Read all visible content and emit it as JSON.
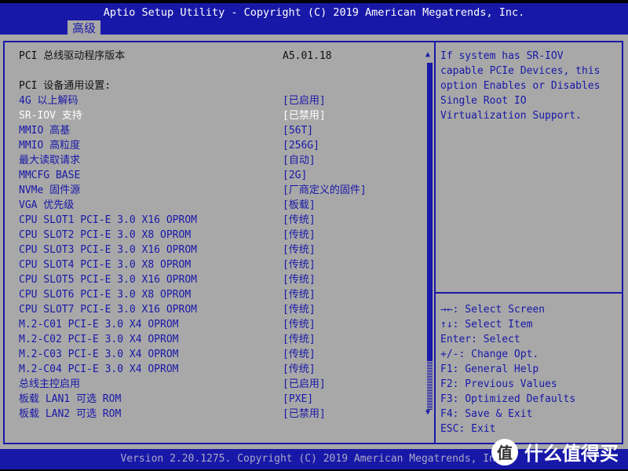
{
  "header": {
    "title": "Aptio Setup Utility - Copyright (C) 2019 American Megatrends, Inc.",
    "tab": "高级"
  },
  "items": [
    {
      "label": "PCI 总线驱动程序版本",
      "value": "A5.01.18",
      "style": "static"
    },
    {
      "label": "",
      "value": "",
      "style": "static"
    },
    {
      "label": "PCI 设备通用设置:",
      "value": "",
      "style": "static"
    },
    {
      "label": "4G 以上解码",
      "value": "[已启用]",
      "style": "link"
    },
    {
      "label": "SR-IOV 支持",
      "value": "[已禁用]",
      "style": "sel"
    },
    {
      "label": "MMIO 高基",
      "value": "[56T]",
      "style": "link"
    },
    {
      "label": "MMIO 高粒度",
      "value": "[256G]",
      "style": "link"
    },
    {
      "label": "最大读取请求",
      "value": "[自动]",
      "style": "link"
    },
    {
      "label": "MMCFG BASE",
      "value": "[2G]",
      "style": "link"
    },
    {
      "label": "NVMe 固件源",
      "value": "[厂商定义的固件]",
      "style": "link"
    },
    {
      "label": "VGA 优先级",
      "value": "[板载]",
      "style": "link"
    },
    {
      "label": "CPU SLOT1 PCI-E 3.0 X16 OPROM",
      "value": "[传统]",
      "style": "link"
    },
    {
      "label": "CPU SLOT2 PCI-E 3.0 X8 OPROM",
      "value": "[传统]",
      "style": "link"
    },
    {
      "label": "CPU SLOT3 PCI-E 3.0 X16 OPROM",
      "value": "[传统]",
      "style": "link"
    },
    {
      "label": "CPU SLOT4 PCI-E 3.0 X8 OPROM",
      "value": "[传统]",
      "style": "link"
    },
    {
      "label": "CPU SLOT5 PCI-E 3.0 X16 OPROM",
      "value": "[传统]",
      "style": "link"
    },
    {
      "label": "CPU SLOT6 PCI-E 3.0 X8 OPROM",
      "value": "[传统]",
      "style": "link"
    },
    {
      "label": "CPU SLOT7 PCI-E 3.0 X16 OPROM",
      "value": "[传统]",
      "style": "link"
    },
    {
      "label": "M.2-C01 PCI-E 3.0 X4 OPROM",
      "value": "[传统]",
      "style": "link"
    },
    {
      "label": "M.2-C02 PCI-E 3.0 X4 OPROM",
      "value": "[传统]",
      "style": "link"
    },
    {
      "label": "M.2-C03 PCI-E 3.0 X4 OPROM",
      "value": "[传统]",
      "style": "link"
    },
    {
      "label": "M.2-C04 PCI-E 3.0 X4 OPROM",
      "value": "[传统]",
      "style": "link"
    },
    {
      "label": "总线主控启用",
      "value": "[已启用]",
      "style": "link"
    },
    {
      "label": "板载 LAN1 可选 ROM",
      "value": "[PXE]",
      "style": "link"
    },
    {
      "label": "板载 LAN2 可选 ROM",
      "value": "[已禁用]",
      "style": "link"
    }
  ],
  "help": {
    "text": "If system has SR-IOV\ncapable PCIe Devices, this\noption Enables or Disables\nSingle Root IO\nVirtualization Support.",
    "keys": "→←: Select Screen\n↑↓: Select Item\nEnter: Select\n+/-: Change Opt.\nF1: General Help\nF2: Previous Values\nF3: Optimized Defaults\nF4: Save & Exit\nESC: Exit"
  },
  "footer": {
    "version": "Version 2.20.1275. Copyright (C) 2019 American Megatrends, Inc."
  },
  "watermark": {
    "logo": "值",
    "text": "什么值得买"
  },
  "colors": {
    "bar": "#1818a8",
    "panel": "#a8a8a8",
    "selected": "#ffffff"
  }
}
